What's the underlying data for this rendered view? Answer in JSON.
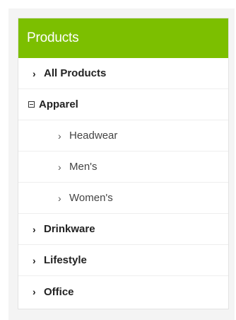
{
  "panel": {
    "title": "Products",
    "header_color": "#7cbf00"
  },
  "menu": {
    "items": [
      {
        "label": "All Products",
        "icon": "chevron-right-icon",
        "expanded": false
      },
      {
        "label": "Apparel",
        "icon": "minus-square-icon",
        "expanded": true,
        "children": [
          {
            "label": "Headwear",
            "icon": "chevron-right-icon"
          },
          {
            "label": "Men's",
            "icon": "chevron-right-icon"
          },
          {
            "label": "Women's",
            "icon": "chevron-right-icon"
          }
        ]
      },
      {
        "label": "Drinkware",
        "icon": "chevron-right-icon",
        "expanded": false
      },
      {
        "label": "Lifestyle",
        "icon": "chevron-right-icon",
        "expanded": false
      },
      {
        "label": "Office",
        "icon": "chevron-right-icon",
        "expanded": false
      }
    ]
  }
}
